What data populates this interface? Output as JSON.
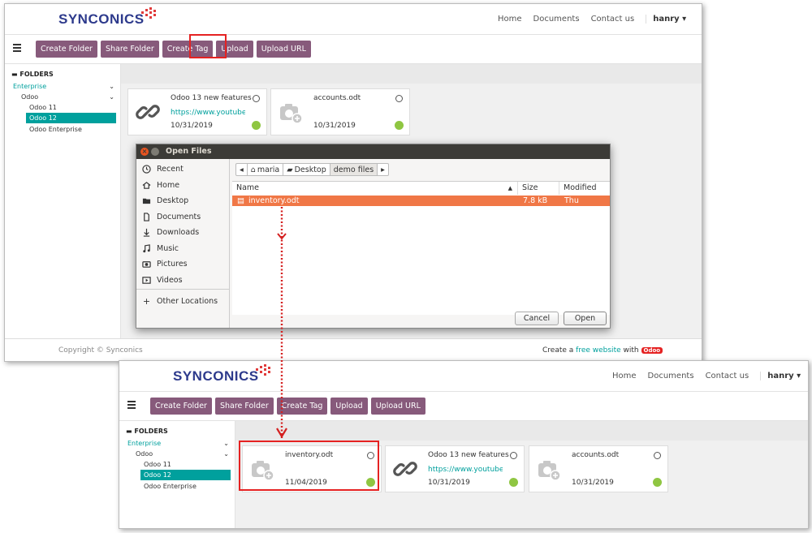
{
  "app": {
    "brand": "SYNCONICS",
    "nav": [
      "Home",
      "Documents",
      "Contact us"
    ],
    "user": "hanry",
    "toolbar": [
      "Create Folder",
      "Share Folder",
      "Create Tag",
      "Upload",
      "Upload URL"
    ],
    "sidebar": {
      "title": "FOLDERS",
      "items": [
        "Enterprise",
        "Odoo",
        "Odoo 11",
        "Odoo 12",
        "Odoo Enterprise"
      ]
    },
    "footer": {
      "copyright": "Copyright © Synconics",
      "create_prefix": "Create a",
      "create_link": "free website",
      "create_with": "with",
      "badge": "Odoo"
    }
  },
  "before": {
    "cards": [
      {
        "name": "Odoo 13 new features",
        "url": "https://www.youtube...",
        "date": "10/31/2019",
        "icon": "link-icon"
      },
      {
        "name": "accounts.odt",
        "url": "",
        "date": "10/31/2019",
        "icon": "camera-placeholder-icon"
      }
    ]
  },
  "dialog": {
    "title": "Open Files",
    "places": [
      "Recent",
      "Home",
      "Desktop",
      "Documents",
      "Downloads",
      "Music",
      "Pictures",
      "Videos",
      "Other Locations"
    ],
    "path": [
      "maria",
      "Desktop",
      "demo files"
    ],
    "columns": [
      "Name",
      "Size",
      "Modified"
    ],
    "files": [
      {
        "name": "inventory.odt",
        "size": "7.8 kB",
        "modified": "Thu"
      }
    ],
    "cancel": "Cancel",
    "open": "Open"
  },
  "after": {
    "cards": [
      {
        "name": "inventory.odt",
        "url": "",
        "date": "11/04/2019",
        "icon": "camera-placeholder-icon"
      },
      {
        "name": "Odoo 13 new features",
        "url": "https://www.youtube...",
        "date": "10/31/2019",
        "icon": "link-icon"
      },
      {
        "name": "accounts.odt",
        "url": "",
        "date": "10/31/2019",
        "icon": "camera-placeholder-icon"
      }
    ]
  },
  "colors": {
    "primary": "#875a7b",
    "link": "#00a09d",
    "highlight": "#e52222",
    "selection": "#f07746",
    "active_folder": "#00a09d"
  }
}
